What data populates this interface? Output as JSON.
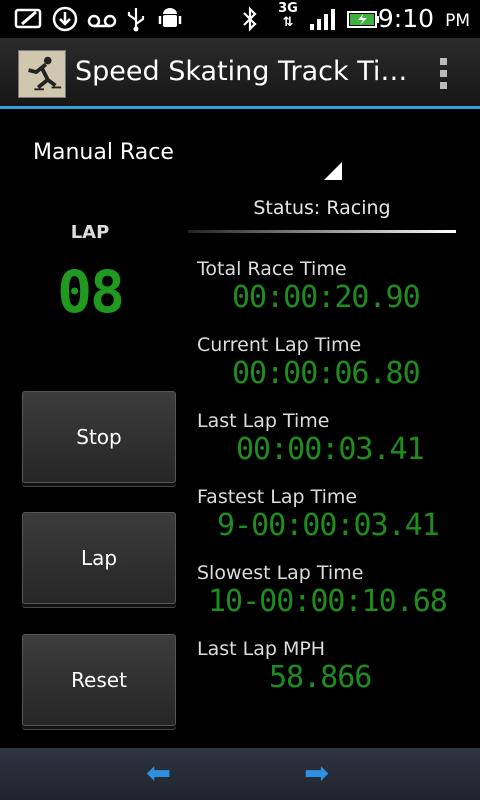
{
  "status_bar": {
    "time": "9:10",
    "ampm": "PM",
    "network": "3G",
    "icons": [
      "mail-icon",
      "download-icon",
      "voicemail-icon",
      "usb-icon",
      "android-debug-icon",
      "bluetooth-icon",
      "network-3g-icon",
      "signal-icon",
      "battery-charging-icon"
    ]
  },
  "action_bar": {
    "title": "Speed Skating Track Ti…",
    "app_icon": "speed-skater-icon",
    "overflow_icon": "overflow-menu-icon"
  },
  "race_mode": {
    "selected": "Manual Race"
  },
  "status": "Status: Racing",
  "lap": {
    "label": "LAP",
    "count": "08"
  },
  "buttons": {
    "stop": "Stop",
    "lap": "Lap",
    "reset": "Reset"
  },
  "metrics": [
    {
      "label": "Total Race Time",
      "value": "00:00:20.90"
    },
    {
      "label": "Current Lap Time",
      "value": "00:00:06.80"
    },
    {
      "label": "Last Lap Time",
      "value": "00:00:03.41"
    },
    {
      "label": "Fastest Lap Time",
      "value": "9-00:00:03.41"
    },
    {
      "label": "Slowest Lap Time",
      "value": "10-00:00:10.68"
    },
    {
      "label": "Last Lap MPH",
      "value": "58.866"
    }
  ],
  "bottom_nav": {
    "prev_icon": "arrow-left-icon",
    "next_icon": "arrow-right-icon"
  },
  "colors": {
    "accent": "#3aa0d8",
    "lcd_green": "#1f8c1f",
    "background": "#000000"
  }
}
